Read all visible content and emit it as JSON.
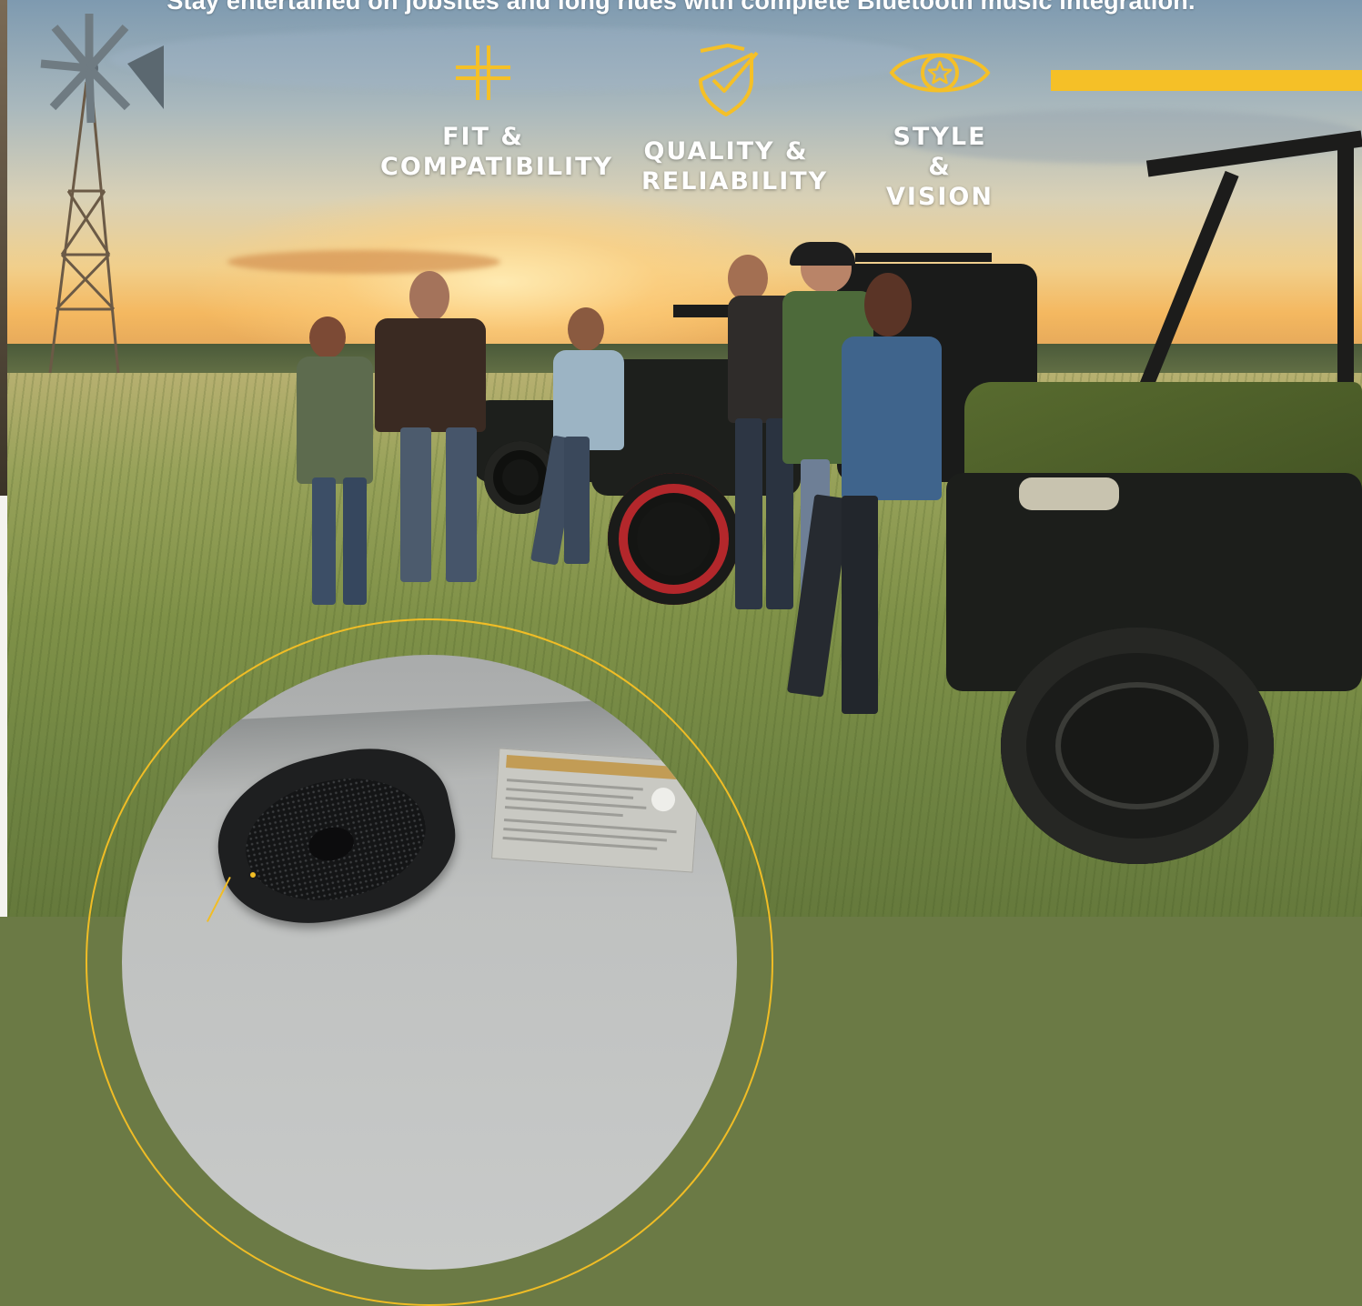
{
  "tagline": "Stay entertained on jobsites and long rides with complete Bluetooth music integration.",
  "features": [
    {
      "icon": "fit-cross-icon",
      "label": "FIT &\nCOMPATIBILITY"
    },
    {
      "icon": "shield-check-icon",
      "label": "QUALITY &\nRELIABILITY"
    },
    {
      "icon": "eye-star-icon",
      "label": "STYLE &\nVISION"
    }
  ],
  "colors": {
    "accent": "#f5c027",
    "text": "#ffffff"
  }
}
